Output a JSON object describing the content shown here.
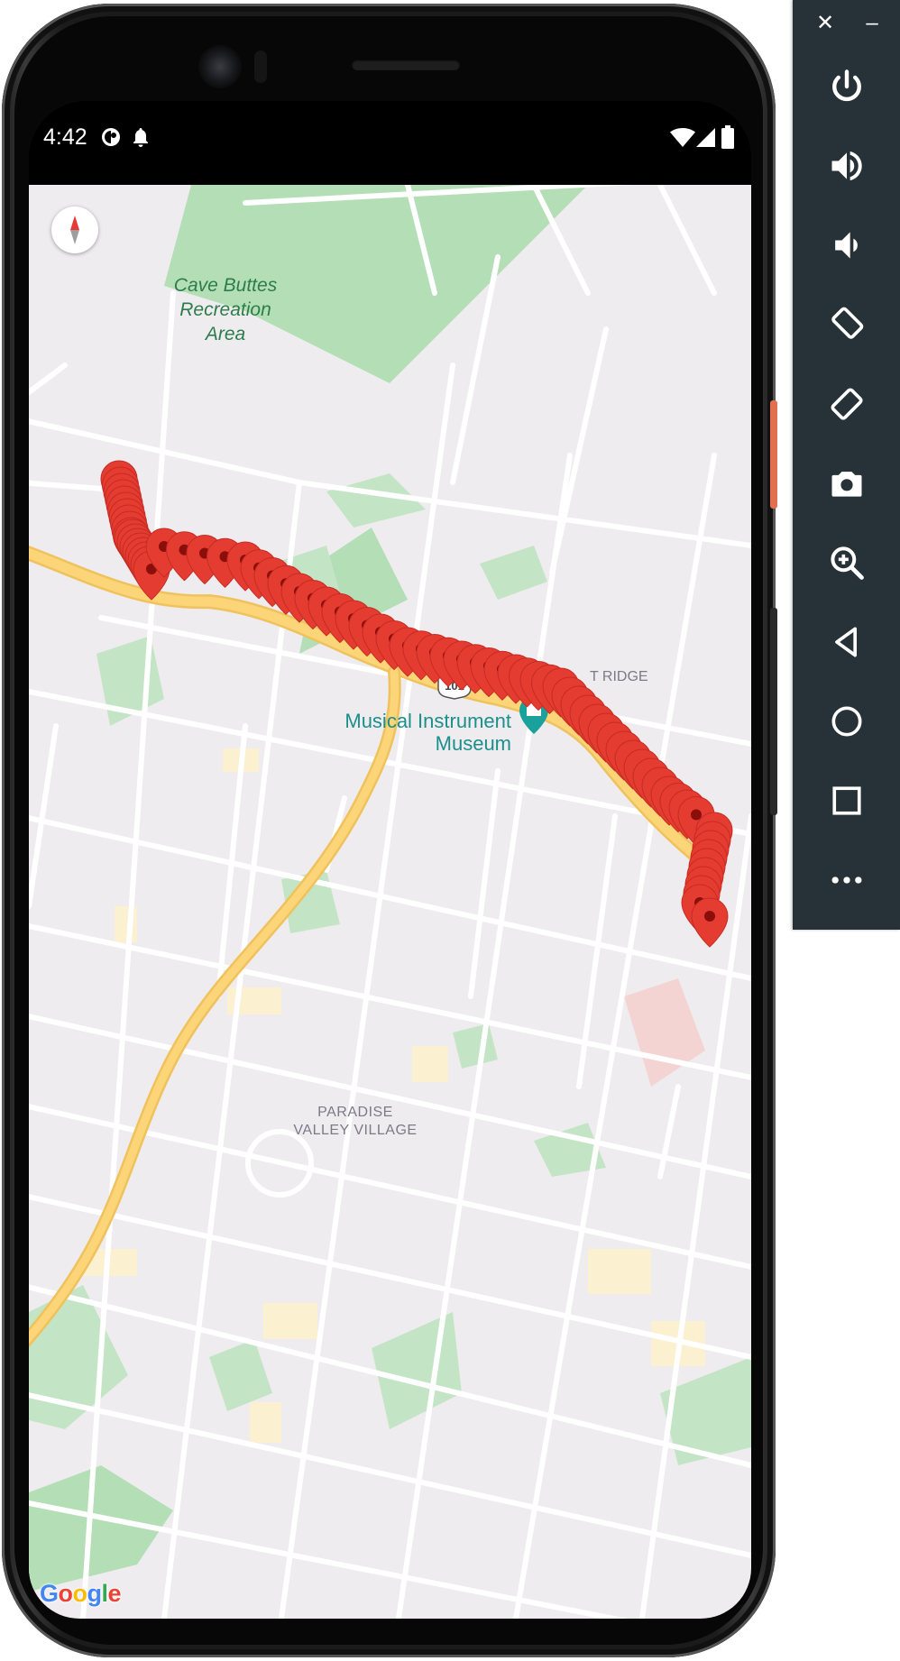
{
  "status_bar": {
    "time": "4:42",
    "left_icons": [
      "data-saver-icon",
      "notification-bell-icon"
    ],
    "right_icons": [
      "wifi-icon",
      "cellular-signal-icon",
      "battery-icon"
    ]
  },
  "map": {
    "provider_logo": "Google",
    "labels": {
      "park": [
        "Cave Buttes",
        "Recreation",
        "Area"
      ],
      "museum": [
        "Musical Instrument",
        "Museum"
      ],
      "neighborhood": [
        "PARADISE",
        "VALLEY VILLAGE"
      ],
      "ridge_partial": "T RIDGE",
      "highway_shield": "101"
    },
    "compass_icon": "compass-icon",
    "marker_icon": "map-pin-icon",
    "colors": {
      "land": "#efecf0",
      "road": "#ffffff",
      "highway": "#fbd578",
      "highway_edge": "#f1c35a",
      "park": "#b4dfb6",
      "park_label": "#2d7d4a",
      "poi_label": "#1c8f8b",
      "neighborhood_label": "#7b7b86",
      "marker": "#e53c32",
      "marker_dot": "#8a0f0a"
    }
  },
  "emulator_toolbar": {
    "close_label": "✕",
    "minimize_label": "–",
    "buttons": [
      {
        "name": "power-icon"
      },
      {
        "name": "volume-up-icon"
      },
      {
        "name": "volume-down-icon"
      },
      {
        "name": "rotate-left-icon"
      },
      {
        "name": "rotate-right-icon"
      },
      {
        "name": "camera-icon"
      },
      {
        "name": "zoom-icon"
      },
      {
        "name": "back-icon"
      },
      {
        "name": "home-icon"
      },
      {
        "name": "overview-icon"
      },
      {
        "name": "more-icon"
      }
    ]
  }
}
